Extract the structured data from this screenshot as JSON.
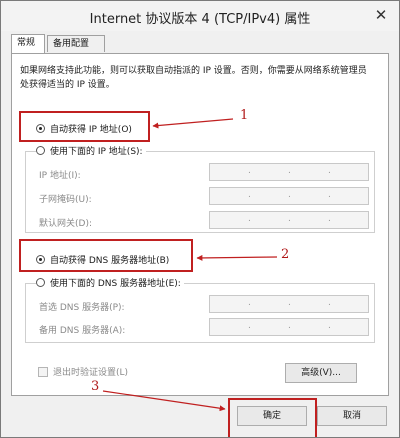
{
  "window": {
    "title": "Internet 协议版本 4 (TCP/IPv4) 属性",
    "close_glyph": "✕"
  },
  "tabs": [
    {
      "label": "常规"
    },
    {
      "label": "备用配置"
    }
  ],
  "description": "如果网络支持此功能，则可以获取自动指派的 IP 设置。否则，你需要从网络系统管理员处获得适当的 IP 设置。",
  "ip_section": {
    "auto_label": "自动获得 IP 地址(O)",
    "manual_label": "使用下面的 IP 地址(S):",
    "auto_selected": true,
    "fields": [
      {
        "label": "IP 地址(I):"
      },
      {
        "label": "子网掩码(U):"
      },
      {
        "label": "默认网关(D):"
      }
    ]
  },
  "dns_section": {
    "auto_label": "自动获得 DNS 服务器地址(B)",
    "manual_label": "使用下面的 DNS 服务器地址(E):",
    "auto_selected": true,
    "fields": [
      {
        "label": "首选 DNS 服务器(P):"
      },
      {
        "label": "备用 DNS 服务器(A):"
      }
    ]
  },
  "ip_placeholder_dot": ".",
  "validate_label": "退出时验证设置(L)",
  "advanced_button": "高级(V)...",
  "ok_button": "确定",
  "cancel_button": "取消",
  "annotations": [
    "1",
    "2",
    "3"
  ],
  "colors": {
    "annotation_red": "#c02020"
  }
}
